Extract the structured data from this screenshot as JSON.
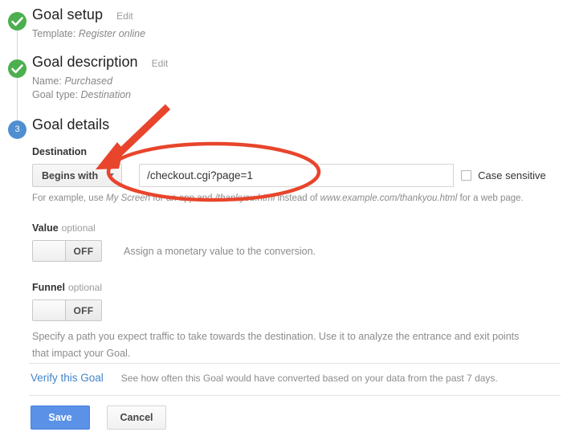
{
  "steps": [
    {
      "id": "goal-setup",
      "marker": "check",
      "title": "Goal setup",
      "edit_label": "Edit",
      "summary_lines": [
        {
          "label": "Template:",
          "value": "Register online"
        }
      ]
    },
    {
      "id": "goal-description",
      "marker": "check",
      "title": "Goal description",
      "edit_label": "Edit",
      "summary_lines": [
        {
          "label": "Name:",
          "value": "Purchased"
        },
        {
          "label": "Goal type:",
          "value": "Destination"
        }
      ]
    },
    {
      "id": "goal-details",
      "marker": "3",
      "title": "Goal details",
      "edit_label": ""
    }
  ],
  "destination": {
    "label": "Destination",
    "match_type": "Begins with",
    "match_caret_icon": "chevron-down-icon",
    "url_value": "/checkout.cgi?page=1",
    "url_placeholder": "",
    "case_sensitive_label": "Case sensitive",
    "case_sensitive_checked": false,
    "help_prefix": "For example, use ",
    "help_em1": "My Screen",
    "help_mid1": " for an app and ",
    "help_em2": "/thankyou.html",
    "help_mid2": " instead of ",
    "help_em3": "www.example.com/thankyou.html",
    "help_suffix": " for a web page."
  },
  "value_field": {
    "label": "Value",
    "optional_label": "optional",
    "toggle_state": "OFF",
    "description": "Assign a monetary value to the conversion."
  },
  "funnel_field": {
    "label": "Funnel",
    "optional_label": "optional",
    "toggle_state": "OFF",
    "description": "Specify a path you expect traffic to take towards the destination. Use it to analyze the entrance and exit points that impact your Goal."
  },
  "footer": {
    "verify_link": "Verify this Goal",
    "verify_note": "See how often this Goal would have converted based on your data from the past 7 days.",
    "save_label": "Save",
    "cancel_label": "Cancel"
  },
  "annotations": {
    "arrow_color": "#e8452c",
    "ellipse_color": "#e8452c",
    "arrow_name": "red-arrow-annotation",
    "ellipse_name": "red-ellipse-annotation"
  },
  "colors": {
    "step_done": "#4caf50",
    "step_current": "#4f8fd0",
    "save_button": "#5b92e8",
    "link": "#4285c8"
  }
}
